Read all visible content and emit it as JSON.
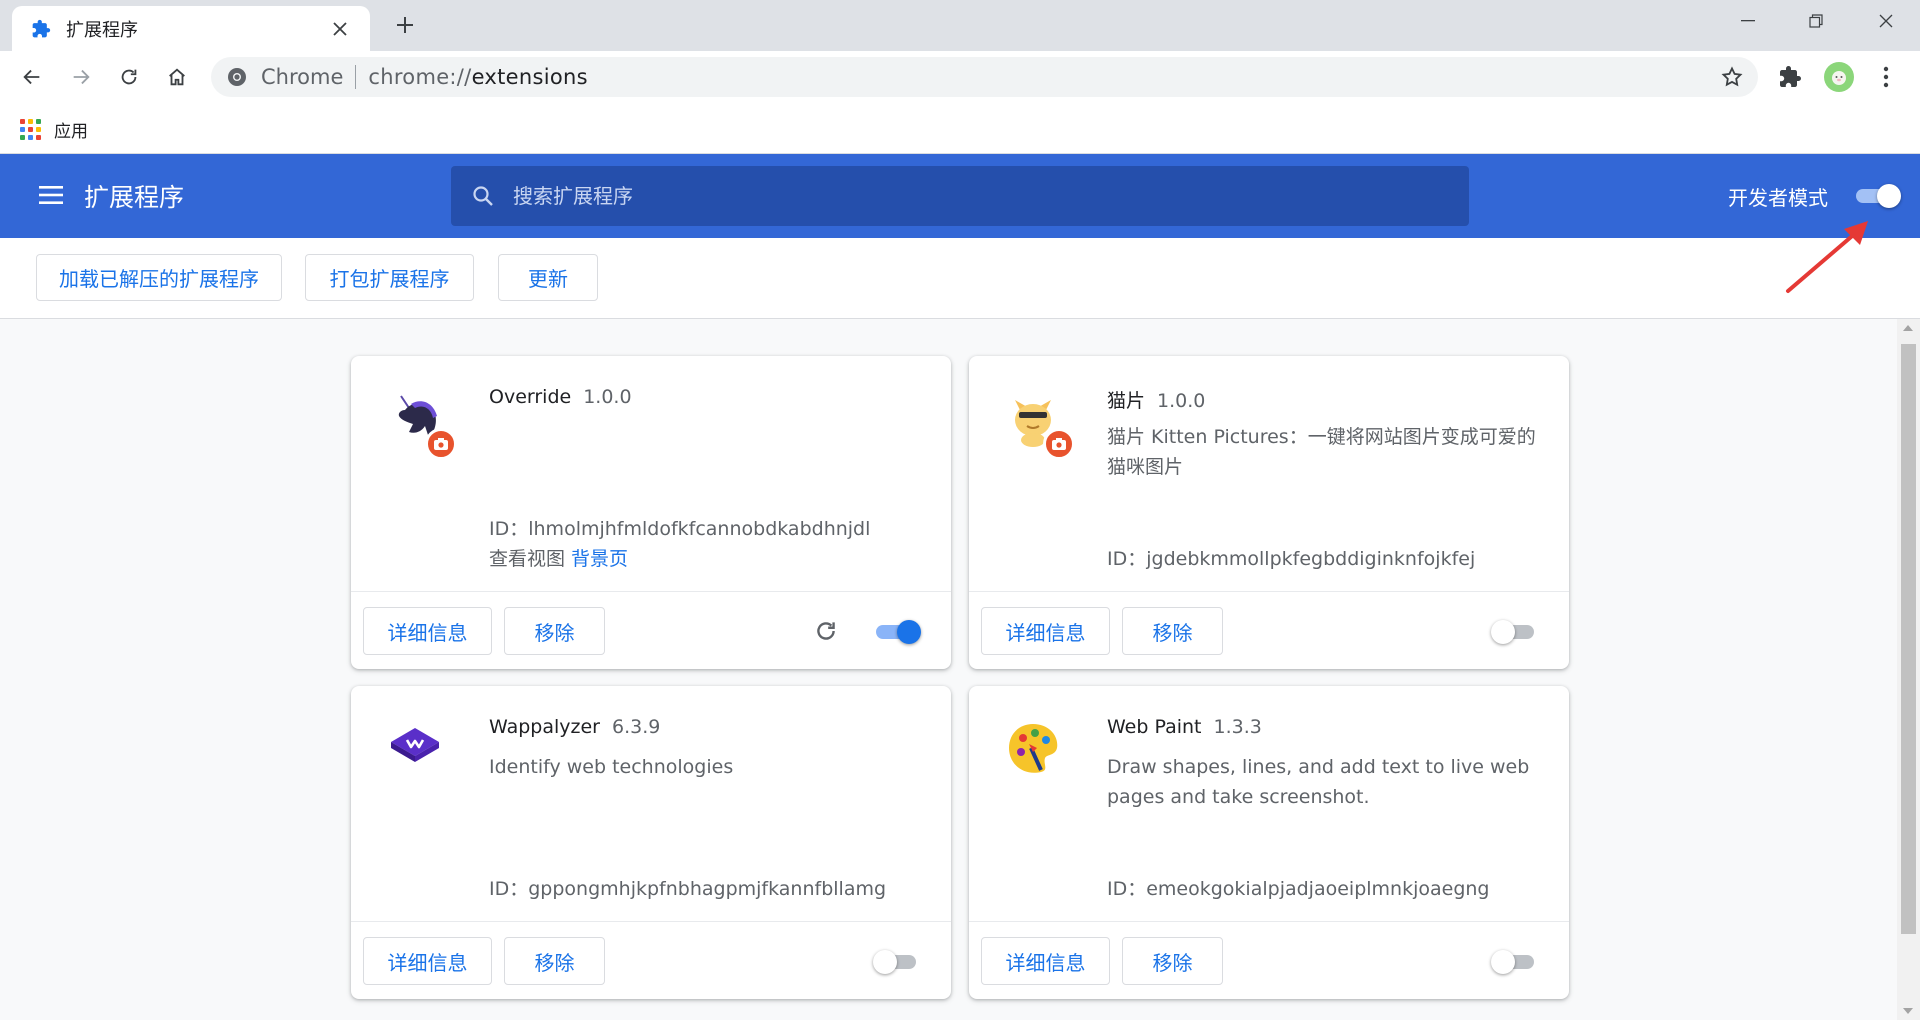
{
  "browser": {
    "tab": {
      "title": "扩展程序",
      "close": "✕"
    },
    "new_tab": "+",
    "omnibox": {
      "chip": "Chrome",
      "url_scheme": "chrome://",
      "url_path": "extensions"
    },
    "bookmarks": {
      "apps_label": "应用"
    }
  },
  "header": {
    "title": "扩展程序",
    "search_placeholder": "搜索扩展程序",
    "dev_mode_label": "开发者模式",
    "dev_mode_on": true
  },
  "dev_toolbar": {
    "load_unpacked": "加载已解压的扩展程序",
    "pack": "打包扩展程序",
    "update": "更新"
  },
  "cards": [
    {
      "name": "Override",
      "version": "1.0.0",
      "description": "",
      "id_label": "ID：",
      "id": "lhmolmjhfmldofkfcannobdkabdhnjdl",
      "views_label": "查看视图",
      "views_link": "背景页",
      "details": "详细信息",
      "remove": "移除",
      "enabled": true,
      "icon": "unicorn-icon"
    },
    {
      "name": "猫片",
      "version": "1.0.0",
      "description": "猫片 Kitten Pictures：一键将网站图片变成可爱的猫咪图片",
      "id_label": "ID：",
      "id": "jgdebkmmollpkfegbddiginknfojkfej",
      "details": "详细信息",
      "remove": "移除",
      "enabled": false,
      "icon": "cat-icon"
    },
    {
      "name": "Wappalyzer",
      "version": "6.3.9",
      "description": "Identify web technologies",
      "id_label": "ID：",
      "id": "gppongmhjkpfnbhagpmjfkannfbllamg",
      "details": "详细信息",
      "remove": "移除",
      "enabled": false,
      "icon": "wappalyzer-icon"
    },
    {
      "name": "Web Paint",
      "version": "1.3.3",
      "description": "Draw shapes, lines, and add text to live web pages and take screenshot.",
      "id_label": "ID：",
      "id": "emeokgokialpjadjaoeiplmnkjoaegng",
      "details": "详细信息",
      "remove": "移除",
      "enabled": false,
      "icon": "palette-icon"
    }
  ],
  "colors": {
    "header_blue": "#3367d6",
    "search_blue": "#254fac",
    "link_blue": "#1a73e8",
    "badge_red": "#e8532d",
    "annotation_red": "#e53935"
  }
}
